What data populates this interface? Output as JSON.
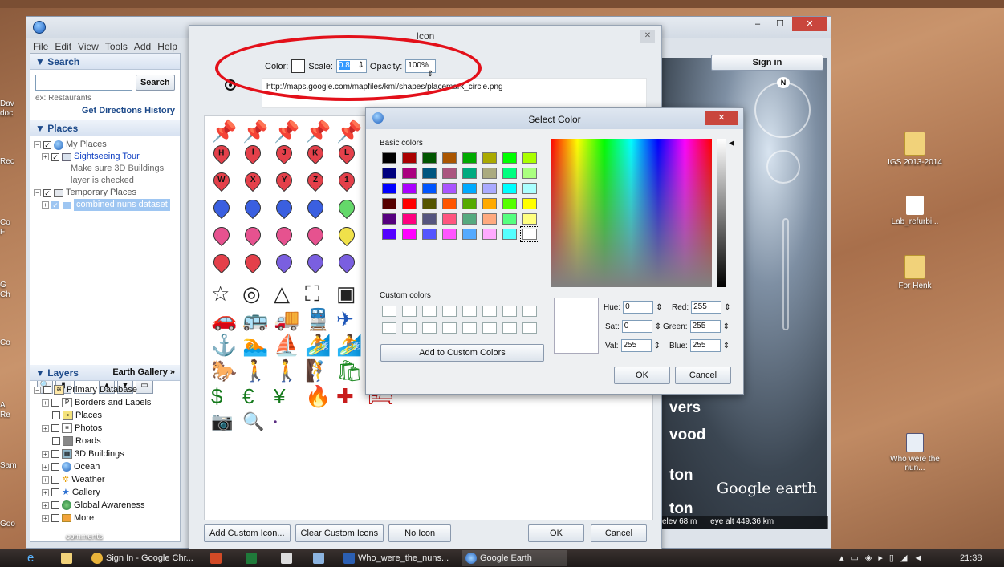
{
  "desktop": {
    "icons_right": [
      {
        "label": "IGS 2013-2014",
        "kind": "folder"
      },
      {
        "label": "Lab_refurbi...",
        "kind": "document"
      },
      {
        "label": "For Henk",
        "kind": "folder"
      },
      {
        "label": "Who were the nun...",
        "kind": "kmz"
      }
    ],
    "left_edge_labels": [
      "Dav",
      "doc",
      "Rec",
      "Co",
      "F",
      "G",
      "Ch",
      "Co",
      "A",
      "Re",
      "Sam",
      "Goo"
    ],
    "comments_text": "comments"
  },
  "google_earth": {
    "menu": [
      "File",
      "Edit",
      "View",
      "Tools",
      "Add",
      "Help"
    ],
    "sign_in": "Sign in",
    "search": {
      "header": "▼ Search",
      "button": "Search",
      "hint": "ex: Restaurants",
      "get_directions": "Get Directions",
      "history": "History"
    },
    "places": {
      "header": "▼ Places",
      "my_places": "My Places",
      "sightseeing_tour": "Sightseeing Tour",
      "note_line1": "Make sure 3D Buildings",
      "note_line2": "layer is checked",
      "temporary_places": "Temporary Places",
      "combined": "combined nuns dataset"
    },
    "layers": {
      "header": "▼ Layers",
      "gallery_link": "Earth Gallery »",
      "items": [
        "Primary Database",
        "Borders and Labels",
        "Places",
        "Photos",
        "Roads",
        "3D Buildings",
        "Ocean",
        "Weather",
        "Gallery",
        "Global Awareness",
        "More"
      ]
    },
    "map": {
      "compass_letter": "N",
      "words": [
        "vers",
        "vood",
        "ton",
        "ton"
      ],
      "logo": "Google earth",
      "status_elev": "elev   68 m",
      "status_alt": "eye alt 449.36 km"
    }
  },
  "icon_dialog": {
    "title": "Icon",
    "color_label": "Color:",
    "scale_label": "Scale:",
    "scale_value": "0.8",
    "opacity_label": "Opacity:",
    "opacity_value": "100%",
    "url": "http://maps.google.com/mapfiles/kml/shapes/placemark_circle.png",
    "pin_letters_row2": [
      "H",
      "I",
      "J",
      "K",
      "L",
      "M"
    ],
    "pin_letters_row3": [
      "W",
      "X",
      "Y",
      "Z",
      "1",
      "2"
    ],
    "symbols": [
      "☆",
      "◎",
      "△",
      "⛶",
      "▣",
      "⊙",
      "🚗",
      "🚌",
      "🚚",
      "🚆",
      "✈",
      "⛵",
      "⚓",
      "🏊",
      "⛵",
      "🏄",
      "🏄",
      "🌲",
      "🐎",
      "🚶",
      "🚶",
      "🧗",
      "🛍",
      "🍴",
      "$",
      "€",
      "¥",
      "🔥",
      "✚",
      "🛏",
      "📷",
      "🔍",
      "•"
    ],
    "buttons": {
      "add_custom": "Add Custom Icon...",
      "clear_custom": "Clear Custom Icons",
      "no_icon": "No Icon",
      "ok": "OK",
      "cancel": "Cancel"
    }
  },
  "select_color": {
    "title": "Select Color",
    "basic_label": "Basic colors",
    "custom_label": "Custom colors",
    "add_custom": "Add to Custom Colors",
    "basic_colors": [
      "#000000",
      "#aa0000",
      "#005500",
      "#aa5500",
      "#00aa00",
      "#aaaa00",
      "#00ff00",
      "#aaff00",
      "#00007f",
      "#aa007f",
      "#00557f",
      "#aa557f",
      "#00aa7f",
      "#aaaa7f",
      "#00ff7f",
      "#aaff7f",
      "#0000ff",
      "#aa00ff",
      "#0055ff",
      "#aa55ff",
      "#00aaff",
      "#aaaaff",
      "#00ffff",
      "#aaffff",
      "#550000",
      "#ff0000",
      "#555500",
      "#ff5500",
      "#55aa00",
      "#ffaa00",
      "#55ff00",
      "#ffff00",
      "#55007f",
      "#ff007f",
      "#55557f",
      "#ff557f",
      "#55aa7f",
      "#ffaa7f",
      "#55ff7f",
      "#ffff7f",
      "#5500ff",
      "#ff00ff",
      "#5555ff",
      "#ff55ff",
      "#55aaff",
      "#ffaaff",
      "#55ffff",
      "#ffffff"
    ],
    "hue_label": "Hue:",
    "hue": "0",
    "sat_label": "Sat:",
    "sat": "0",
    "val_label": "Val:",
    "val": "255",
    "red_label": "Red:",
    "red": "255",
    "green_label": "Green:",
    "green": "255",
    "blue_label": "Blue:",
    "blue": "255",
    "ok": "OK",
    "cancel": "Cancel"
  },
  "taskbar": {
    "items": [
      "Sign In - Google Chr...",
      "Who_were_the_nuns...",
      "Google Earth"
    ],
    "clock": "21:38"
  },
  "colors": {
    "annotation_ellipse": "#e3101a",
    "accent": "#1d4a8a"
  }
}
